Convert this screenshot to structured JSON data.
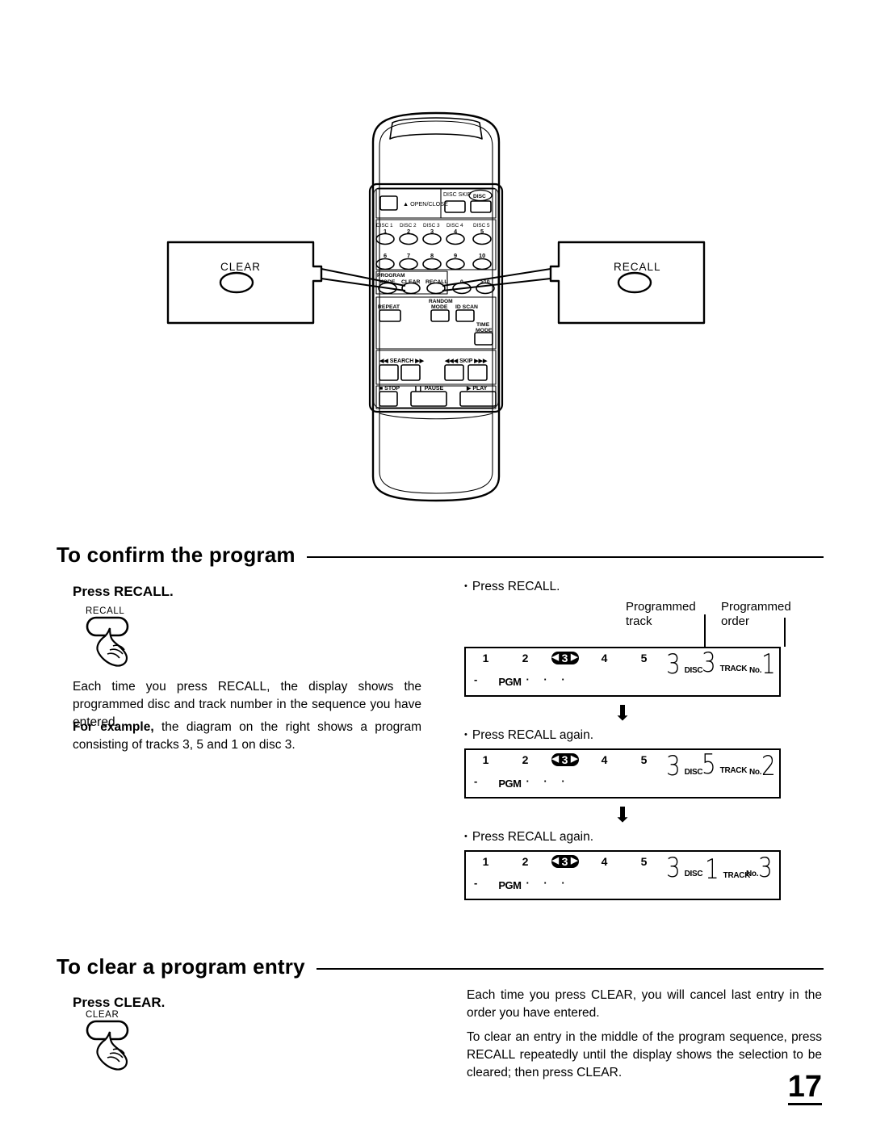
{
  "page": {
    "number": "17"
  },
  "figure": {
    "name": "remote-control-diagram",
    "callout_left": {
      "label": "CLEAR"
    },
    "callout_right": {
      "label": "RECALL"
    },
    "remote": {
      "open_close": "OPEN/CLOSE",
      "disc_skip": "DISC SKIP",
      "disc_skip_badge": "DISC",
      "disc_labels": [
        "DISC 1",
        "DISC 2",
        "DISC 3",
        "DISC 4",
        "DISC 5"
      ],
      "number_row_1": [
        "1",
        "2",
        "3",
        "4",
        "5"
      ],
      "number_row_2": [
        "6",
        "7",
        "8",
        "9",
        "10"
      ],
      "program_label": "PROGRAM",
      "program_row": [
        "MODE",
        "CLEAR",
        "RECALL",
        "0",
        ">10"
      ],
      "repeat": "REPEAT",
      "random": "RANDOM",
      "random_mode": "MODE",
      "id_scan": "ID SCAN",
      "time": "TIME",
      "time_mode": "MODE",
      "search": "SEARCH",
      "skip": "SKIP",
      "stop": "STOP",
      "pause": "PAUSE",
      "play": "PLAY"
    }
  },
  "confirm_section": {
    "heading": "To confirm the program",
    "subheading": "Press RECALL.",
    "button_label": "RECALL",
    "paragraph_1": "Each time you press RECALL, the display shows the programmed disc and track number in the sequence you have entered.",
    "paragraph_2_bold": "For example,",
    "paragraph_2_rest": " the diagram on the right shows a program consisting of tracks 3, 5 and 1 on disc 3."
  },
  "display_column": {
    "callouts": {
      "track": "Programmed\ntrack",
      "track_line1": "Programmed",
      "track_line2": "track",
      "order_line1": "Programmed",
      "order_line2": "order"
    },
    "arrow_glyph": "⬇",
    "steps": [
      {
        "label": "Press RECALL.",
        "bullet": "•",
        "panel": {
          "disc_numbers": [
            "1",
            "2",
            "3",
            "4",
            "5"
          ],
          "selected_disc": "3",
          "dash": "-",
          "pgm": "PGM",
          "dots": "· · ·",
          "disc_digit": "3",
          "disc_caption": "DISC",
          "track_digit": "3",
          "track_caption": "TRACK",
          "order_digit": "1",
          "order_caption": "No."
        }
      },
      {
        "label": "Press RECALL again.",
        "bullet": "•",
        "panel": {
          "disc_numbers": [
            "1",
            "2",
            "3",
            "4",
            "5"
          ],
          "selected_disc": "3",
          "dash": "-",
          "pgm": "PGM",
          "dots": "· · ·",
          "disc_digit": "3",
          "disc_caption": "DISC",
          "track_digit": "5",
          "track_caption": "TRACK",
          "order_digit": "2",
          "order_caption": "No."
        }
      },
      {
        "label": "Press RECALL again.",
        "bullet": "•",
        "panel": {
          "disc_numbers": [
            "1",
            "2",
            "3",
            "4",
            "5"
          ],
          "selected_disc": "3",
          "dash": "-",
          "pgm": "PGM",
          "dots": "· · ·",
          "disc_digit": "3",
          "disc_caption": "DISC",
          "track_digit": "1",
          "track_caption": "TRACK",
          "order_digit": "3",
          "order_caption": "No."
        }
      }
    ]
  },
  "clear_section": {
    "heading": "To clear a program entry",
    "subheading": "Press CLEAR.",
    "button_label": "CLEAR",
    "paragraph_1": "Each time you press CLEAR, you will cancel last entry in the order you have entered.",
    "paragraph_2": "To clear an entry in the middle of the program sequence, press RECALL repeatedly until the display shows the selection to be cleared; then press CLEAR."
  },
  "colors": {
    "ink": "#000000",
    "paper": "#ffffff"
  }
}
